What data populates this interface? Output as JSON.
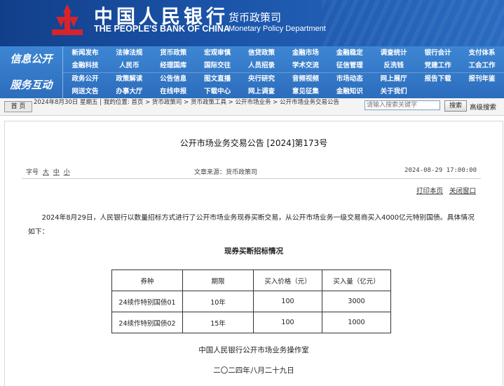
{
  "header": {
    "bank_name_cn": "中国人民银行",
    "bank_name_en": "THE PEOPLE'S BANK OF CHINA",
    "dept_cn": "货币政策司",
    "dept_en": "Monetary Policy Department",
    "brand_color": "#1b55aa"
  },
  "nav": {
    "section1": "信息公开",
    "section2": "服务互动",
    "rows": [
      [
        "新闻发布",
        "法律法规",
        "货币政策",
        "宏观审慎",
        "信贷政策",
        "金融市场",
        "金融稳定",
        "调查统计",
        "银行会计",
        "支付体系"
      ],
      [
        "金融科技",
        "人民币",
        "经理国库",
        "国际交往",
        "人员招录",
        "学术交流",
        "征信管理",
        "反洗钱",
        "党建工作",
        "工会工作"
      ],
      [
        "政务公开",
        "政策解读",
        "公告信息",
        "图文直播",
        "央行研究",
        "音频视频",
        "市场动态",
        "网上展厅",
        "报告下载",
        "报刊年鉴"
      ],
      [
        "网送文告",
        "办事大厅",
        "在线申报",
        "下载中心",
        "网上调查",
        "意见征集",
        "金融知识",
        "关于我们",
        "",
        ""
      ]
    ]
  },
  "breadcrumb": {
    "home": "首 页",
    "text": "2024年8月30日 星期五 | 我的位置: 首页 > 货币政策司 > 货币政策工具 > 公开市场业务 > 公开市场业务交易公告",
    "search_placeholder": "请输入搜索关键字",
    "search_button": "搜索",
    "advanced_search": "高级搜索"
  },
  "article": {
    "title": "公开市场业务交易公告 [2024]第173号",
    "font_size_label": "字号",
    "font_sizes": [
      "大",
      "中",
      "小"
    ],
    "source": "文章来源：货币政策司",
    "date": "2024-08-29 17:00:00",
    "print": "打印本页",
    "close": "关闭窗口",
    "paragraph": "2024年8月29日，人民银行以数量招标方式进行了公开市场业务现券买断交易，从公开市场业务一级交易商买入4000亿元特别国债。具体情况如下：",
    "table_title": "现券买断招标情况",
    "table_headers": [
      "券种",
      "期限",
      "买入价格（元）",
      "买入量（亿元）"
    ],
    "table_rows": [
      [
        "24续作特别国债01",
        "10年",
        "100",
        "3000"
      ],
      [
        "24续作特别国债02",
        "15年",
        "100",
        "1000"
      ]
    ],
    "issuer": "中国人民银行公开市场业务操作室",
    "sign_date": "二〇二四年八月二十九日"
  }
}
